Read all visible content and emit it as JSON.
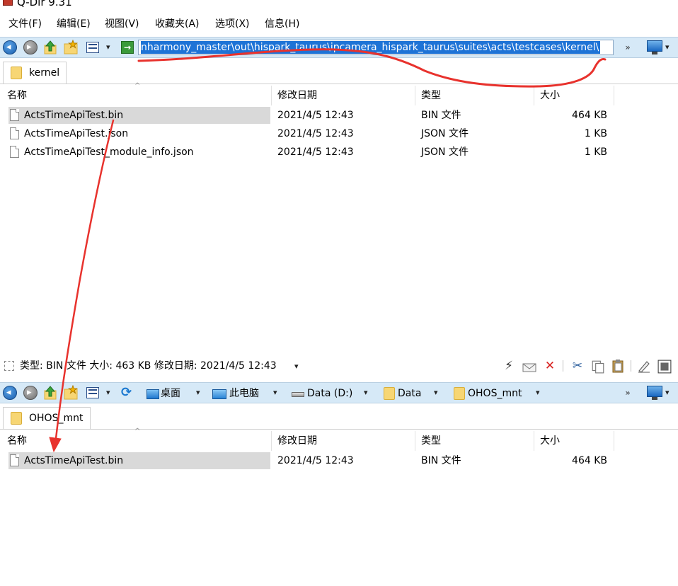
{
  "window": {
    "title": "Q-Dir 9.31"
  },
  "menu": [
    "文件(F)",
    "编辑(E)",
    "视图(V)",
    "收藏夹(A)",
    "选项(X)",
    "信息(H)"
  ],
  "top_pane": {
    "address": "nharmony_master\\out\\hispark_taurus\\ipcamera_hispark_taurus\\suites\\acts\\testcases\\kernel\\",
    "tab": "kernel",
    "columns": [
      "名称",
      "修改日期",
      "类型",
      "大小"
    ],
    "files": [
      {
        "name": "ActsTimeApiTest.bin",
        "date": "2021/4/5 12:43",
        "type": "BIN 文件",
        "size": "464 KB"
      },
      {
        "name": "ActsTimeApiTest.json",
        "date": "2021/4/5 12:43",
        "type": "JSON 文件",
        "size": "1 KB"
      },
      {
        "name": "ActsTimeApiTest_module_info.json",
        "date": "2021/4/5 12:43",
        "type": "JSON 文件",
        "size": "1 KB"
      }
    ]
  },
  "status": {
    "text": "类型: BIN 文件 大小: 463 KB 修改日期: 2021/4/5 12:43"
  },
  "bottom_pane": {
    "breadcrumbs": [
      "桌面",
      "此电脑",
      "Data (D:)",
      "Data",
      "OHOS_mnt"
    ],
    "tab": "OHOS_mnt",
    "columns": [
      "名称",
      "修改日期",
      "类型",
      "大小"
    ],
    "files": [
      {
        "name": "ActsTimeApiTest.bin",
        "date": "2021/4/5 12:43",
        "type": "BIN 文件",
        "size": "464 KB"
      }
    ]
  },
  "glyphs": {
    "caret": "▾",
    "more": "»",
    "sort": "^",
    "lightning": "⚡",
    "close": "✕",
    "scissors": "✂"
  },
  "annotation_color": "#e8322d"
}
